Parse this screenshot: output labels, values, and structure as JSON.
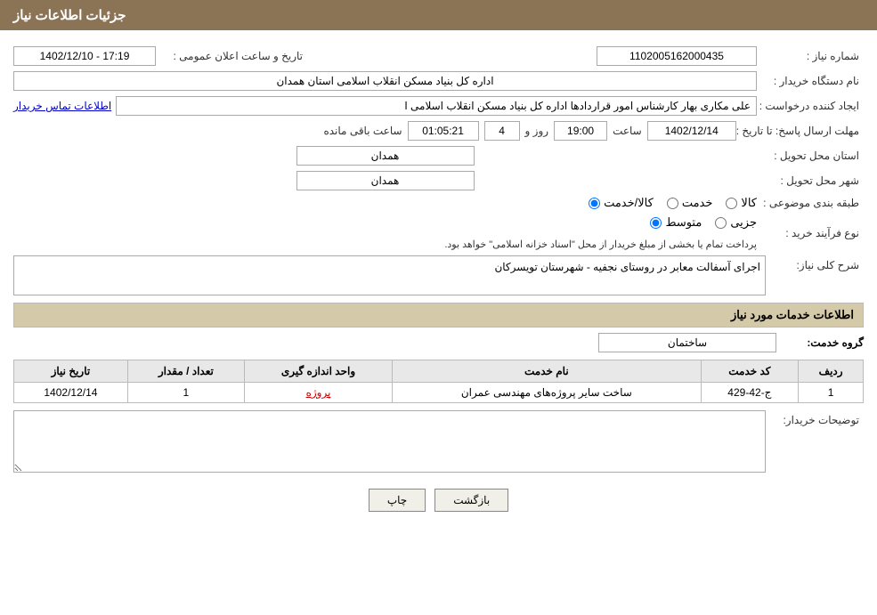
{
  "page": {
    "title": "جزئیات اطلاعات نیاز",
    "header_bg": "#8B7355",
    "header_color": "#fff"
  },
  "fields": {
    "need_number_label": "شماره نیاز :",
    "need_number_value": "1102005162000435",
    "buyer_org_label": "نام دستگاه خریدار :",
    "buyer_org_value": "اداره کل بنیاد مسکن انقلاب اسلامی استان همدان",
    "creator_label": "ایجاد کننده درخواست :",
    "creator_value": "علی مکاری بهار کارشناس امور قراردادها اداره کل بنیاد مسکن انقلاب اسلامی ا",
    "creator_link": "اطلاعات تماس خریدار",
    "send_deadline_label": "مهلت ارسال پاسخ: تا تاریخ :",
    "date_value": "1402/12/14",
    "time_label": "ساعت",
    "time_value": "19:00",
    "days_label": "روز و",
    "days_value": "4",
    "remaining_label": "ساعت باقی مانده",
    "remaining_value": "01:05:21",
    "announcement_label": "تاریخ و ساعت اعلان عمومی :",
    "announcement_value": "1402/12/10 - 17:19",
    "province_label": "استان محل تحویل :",
    "province_value": "همدان",
    "city_label": "شهر محل تحویل :",
    "city_value": "همدان",
    "category_label": "طبقه بندی موضوعی :",
    "category_goods": "کالا",
    "category_service": "خدمت",
    "category_goods_service": "کالا/خدمت",
    "purchase_type_label": "نوع فرآیند خرید :",
    "purchase_partial": "جزیی",
    "purchase_medium": "متوسط",
    "purchase_note": "پرداخت تمام یا بخشی از مبلغ خریدار از محل \"اسناد خزانه اسلامی\" خواهد بود.",
    "need_desc_label": "شرح کلی نیاز:",
    "need_desc_value": "اجرای آسفالت معابر در روستای نجفیه - شهرستان تویسرکان",
    "services_section_label": "اطلاعات خدمات مورد نیاز",
    "group_service_label": "گروه خدمت:",
    "group_service_value": "ساختمان",
    "table_headers": {
      "row_num": "ردیف",
      "service_code": "کد خدمت",
      "service_name": "نام خدمت",
      "unit": "واحد اندازه گیری",
      "quantity": "تعداد / مقدار",
      "need_date": "تاریخ نیاز"
    },
    "table_rows": [
      {
        "row_num": "1",
        "service_code": "ج-42-429",
        "service_name": "ساخت سایر پروژه‌های مهندسی عمران",
        "unit": "پروژه",
        "quantity": "1",
        "need_date": "1402/12/14"
      }
    ],
    "buyer_desc_label": "توضیحات خریدار:",
    "buyer_desc_value": "",
    "back_button": "بازگشت",
    "print_button": "چاپ"
  }
}
